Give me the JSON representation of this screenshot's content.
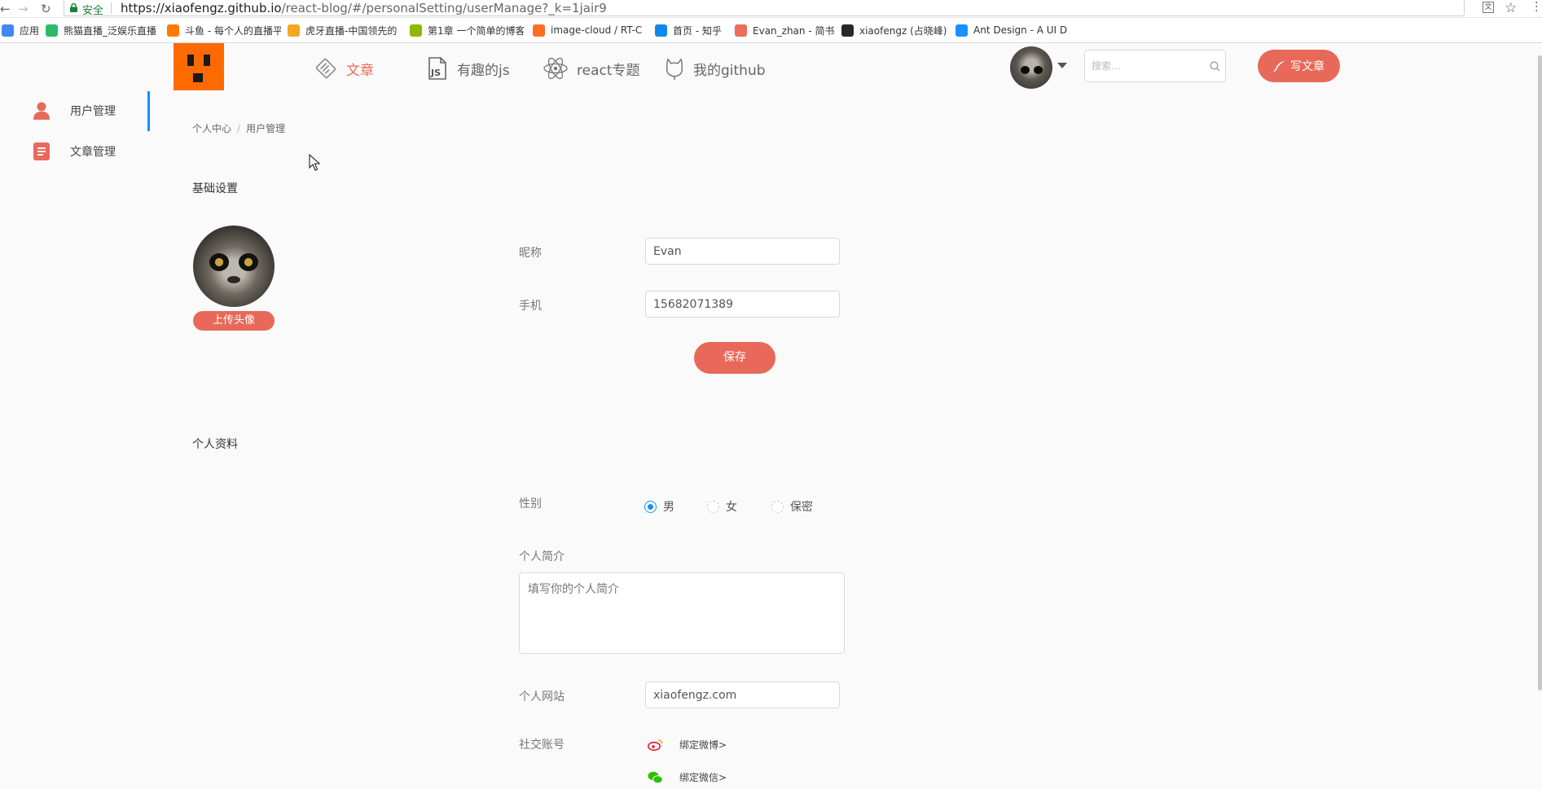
{
  "browser": {
    "secure_label": "安全",
    "url_host": "https://xiaofengz.github.io",
    "url_path": "/react-blog/#/personalSetting/userManage?_k=1jair9",
    "bookmarks": [
      {
        "label": "应用",
        "color": "#4285f4"
      },
      {
        "label": "熊猫直播_泛娱乐直播",
        "color": "#2bbc6a"
      },
      {
        "label": "斗鱼 - 每个人的直播平",
        "color": "#ff7a00"
      },
      {
        "label": "虎牙直播-中国领先的",
        "color": "#f5a623"
      },
      {
        "label": "第1章 一个简单的博客",
        "color": "#8cb800"
      },
      {
        "label": "image-cloud / RT-C",
        "color": "#fc6d26"
      },
      {
        "label": "首页 - 知乎",
        "color": "#0f88eb"
      },
      {
        "label": "Evan_zhan - 简书",
        "color": "#ea6f5a"
      },
      {
        "label": "xiaofengz (占晓峰)",
        "color": "#24292e"
      },
      {
        "label": "Ant Design - A UI D",
        "color": "#1890ff"
      }
    ]
  },
  "header": {
    "nav": [
      {
        "label": "文章",
        "icon": "article-icon",
        "active": true
      },
      {
        "label": "有趣的js",
        "icon": "js-icon",
        "active": false
      },
      {
        "label": "react专题",
        "icon": "react-icon",
        "active": false
      },
      {
        "label": "我的github",
        "icon": "github-icon",
        "active": false
      }
    ],
    "search_placeholder": "搜索...",
    "write_label": "写文章"
  },
  "sidebar": {
    "items": [
      {
        "label": "用户管理",
        "icon": "user-icon",
        "active": true
      },
      {
        "label": "文章管理",
        "icon": "document-icon",
        "active": false
      }
    ]
  },
  "breadcrumb": [
    "个人中心",
    "用户管理"
  ],
  "basic": {
    "title": "基础设置",
    "upload_label": "上传头像",
    "nickname_label": "昵称",
    "nickname_value": "Evan",
    "phone_label": "手机",
    "phone_value": "15682071389",
    "save_label": "保存"
  },
  "profile": {
    "title": "个人资料",
    "gender_label": "性别",
    "gender_options": [
      "男",
      "女",
      "保密"
    ],
    "gender_selected": "男",
    "bio_label": "个人简介",
    "bio_placeholder": "填写你的个人简介",
    "website_label": "个人网站",
    "website_value": "xiaofengz.com",
    "social_label": "社交账号",
    "social": [
      {
        "label": "绑定微博>",
        "icon": "weibo-icon"
      },
      {
        "label": "绑定微信>",
        "icon": "wechat-icon"
      }
    ]
  },
  "colors": {
    "accent": "#e8695a",
    "active_bar": "#1890ff",
    "logo": "#ff6a00"
  }
}
